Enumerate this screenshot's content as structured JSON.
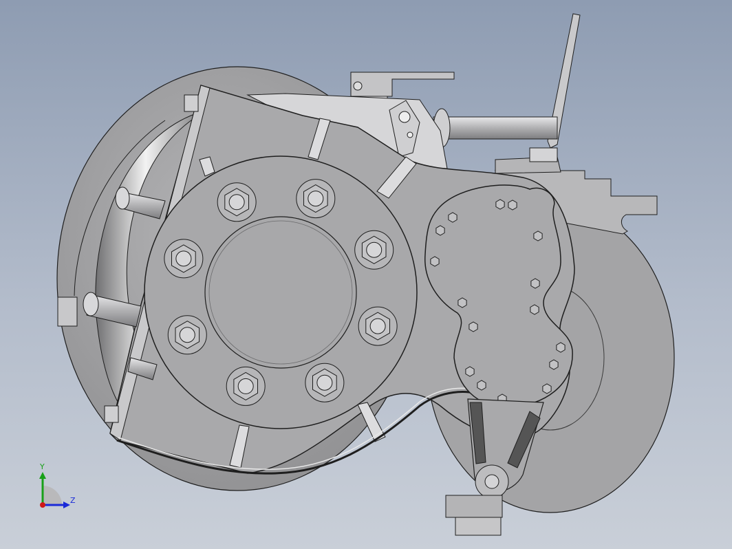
{
  "viewport": {
    "background_top": "#8e9cb2",
    "background_bottom": "#c9cfd8"
  },
  "model": {
    "part_color": "#a9a9ab",
    "edge_color": "#1e1e1e",
    "flange_bolt_count": 8,
    "cover_bolt_count": 16
  },
  "triad": {
    "y_label": "Y",
    "z_label": "Z",
    "y_color": "#18a018",
    "z_color": "#1a2ad8",
    "x_color": "#d01818"
  }
}
